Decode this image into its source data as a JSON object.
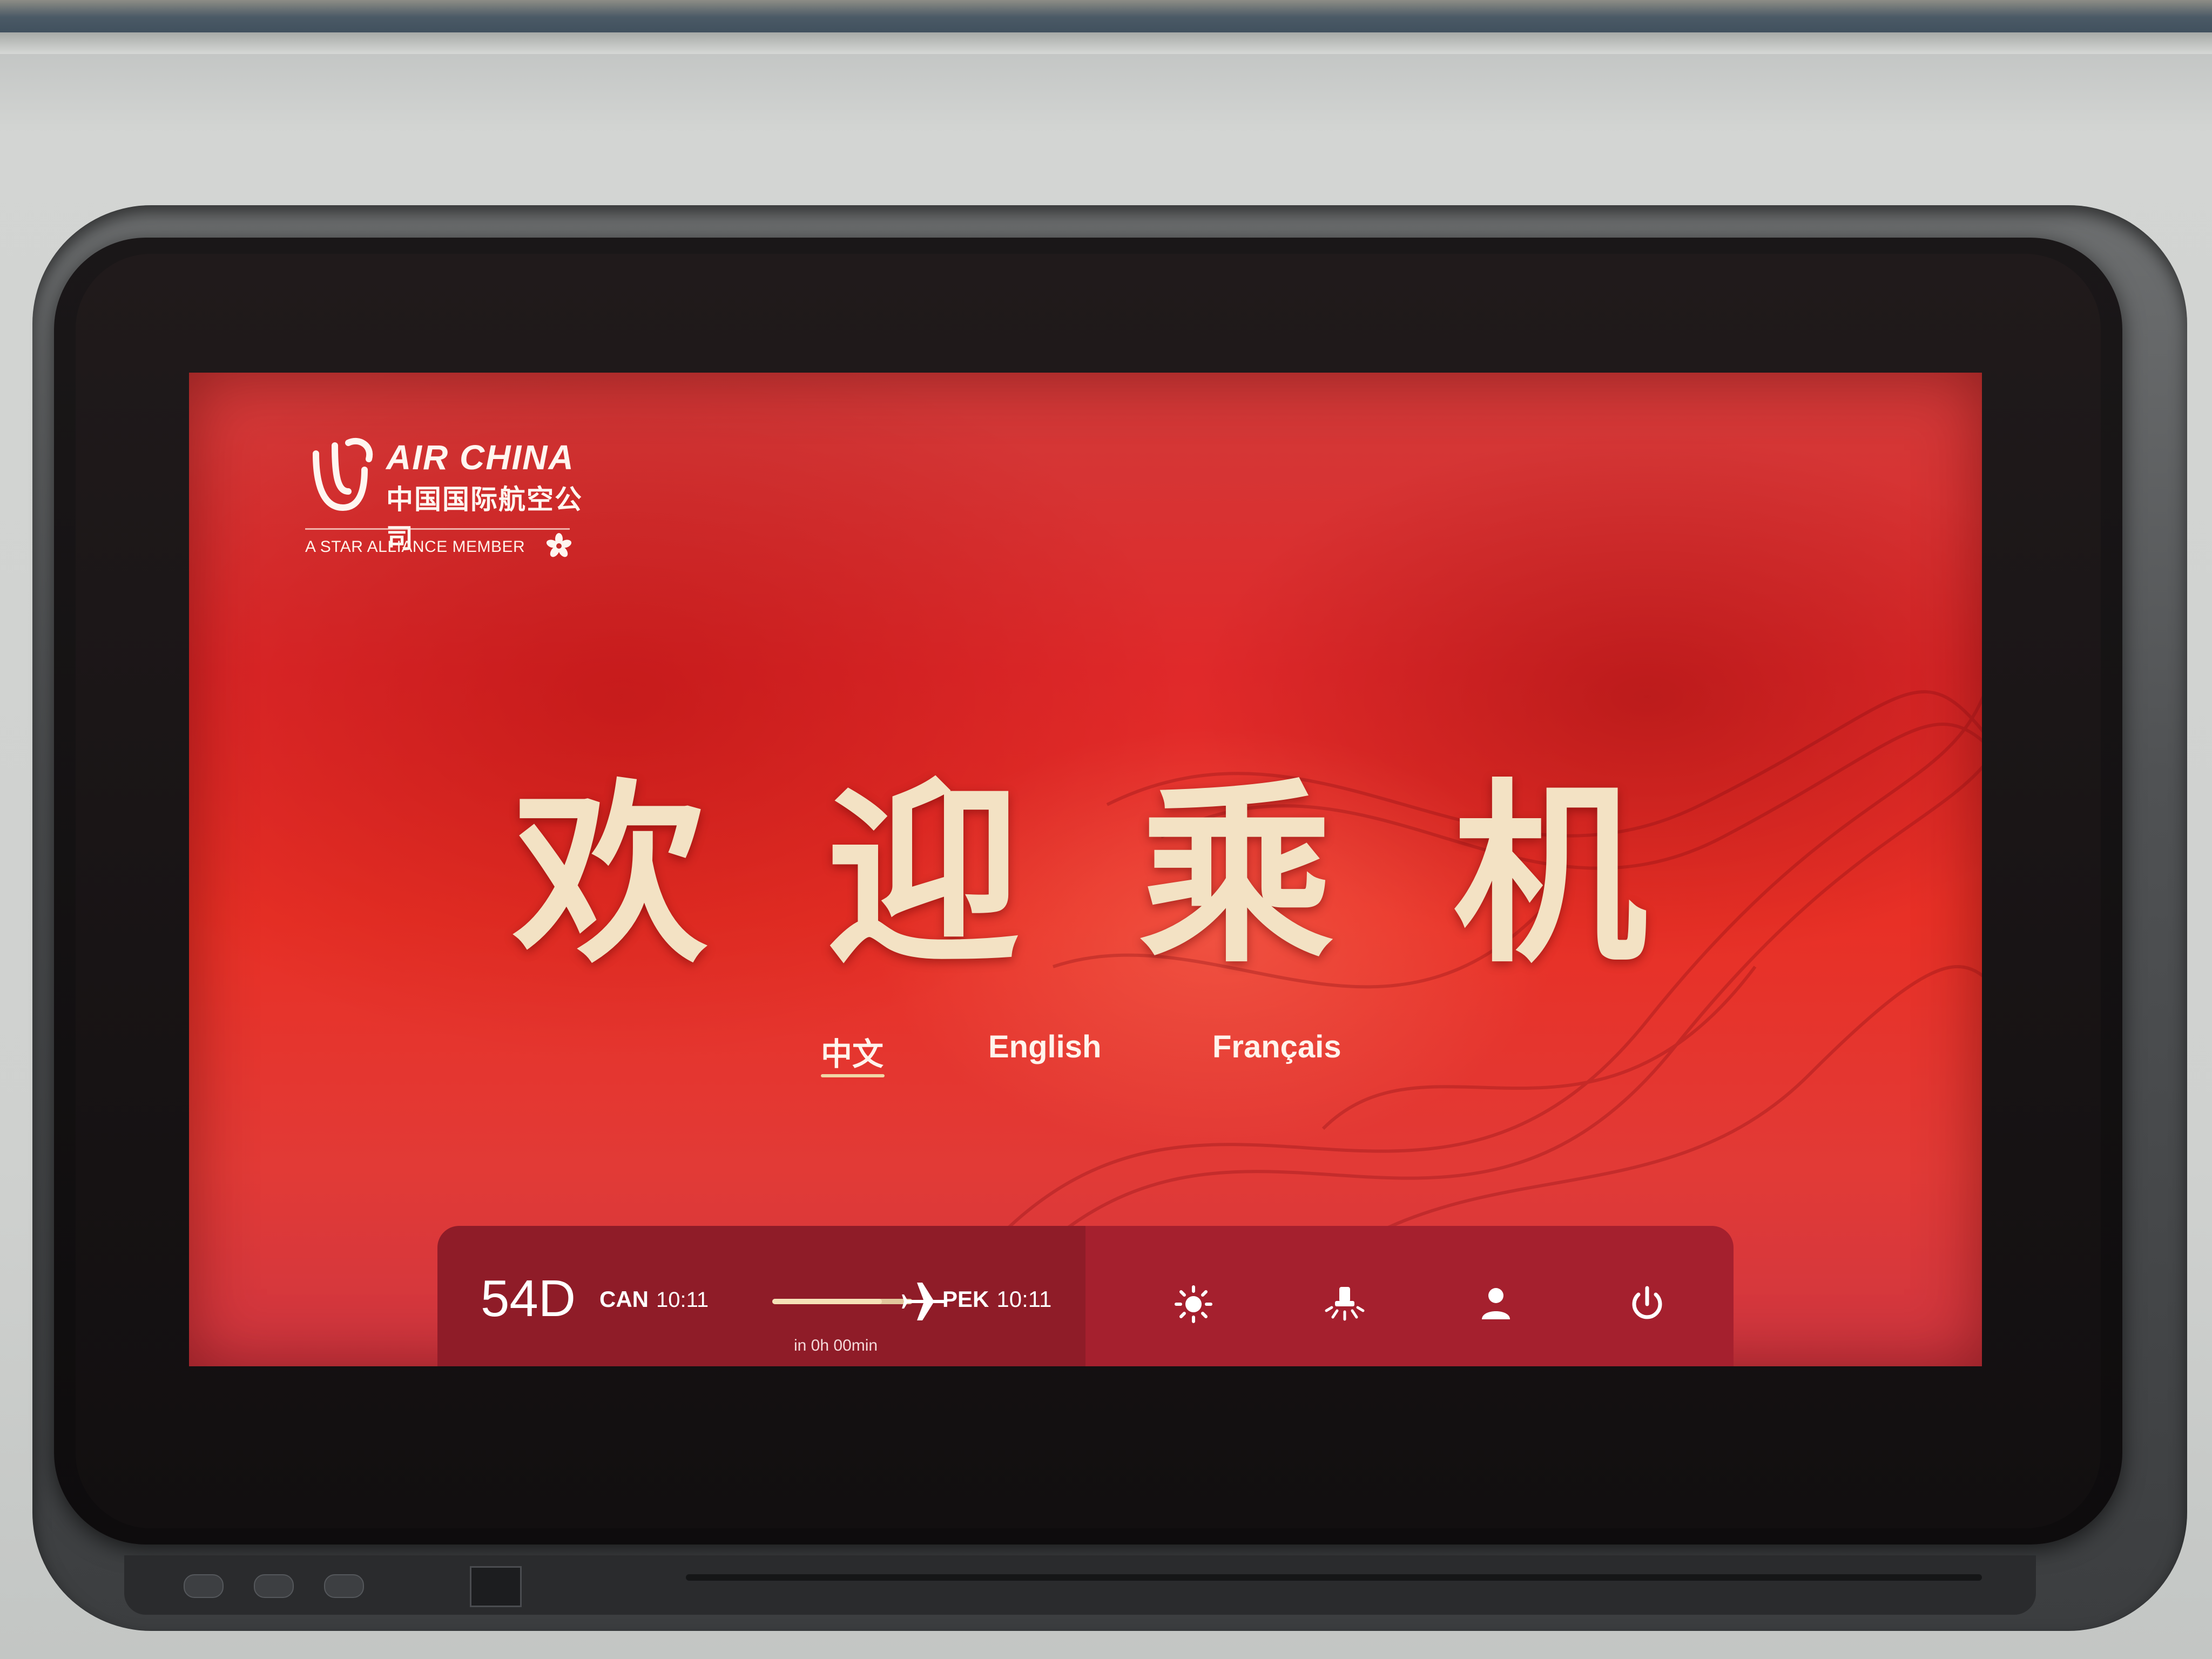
{
  "logo": {
    "title": "AIR CHINA",
    "subtitle": "中国国际航空公司",
    "alliance": "A STAR ALLIANCE MEMBER"
  },
  "welcome": {
    "chars": [
      "欢",
      "迎",
      "乘",
      "机"
    ]
  },
  "languages": {
    "items": [
      "中文",
      "English",
      "Français"
    ],
    "selected": "中文"
  },
  "status": {
    "seat": "54D",
    "origin_code": "CAN",
    "origin_time": "10:11",
    "dest_code": "PEK",
    "dest_time": "10:11",
    "eta": "in 0h 00min",
    "progress": 0.78
  },
  "controls": {
    "icons": [
      "brightness-icon",
      "reading-light-icon",
      "attendant-call-icon",
      "power-icon"
    ]
  },
  "colors": {
    "screen_red": "#e2302a",
    "gold": "#f3e2c4",
    "status_dark": "#8f1c28",
    "status_light": "#a5202e"
  }
}
